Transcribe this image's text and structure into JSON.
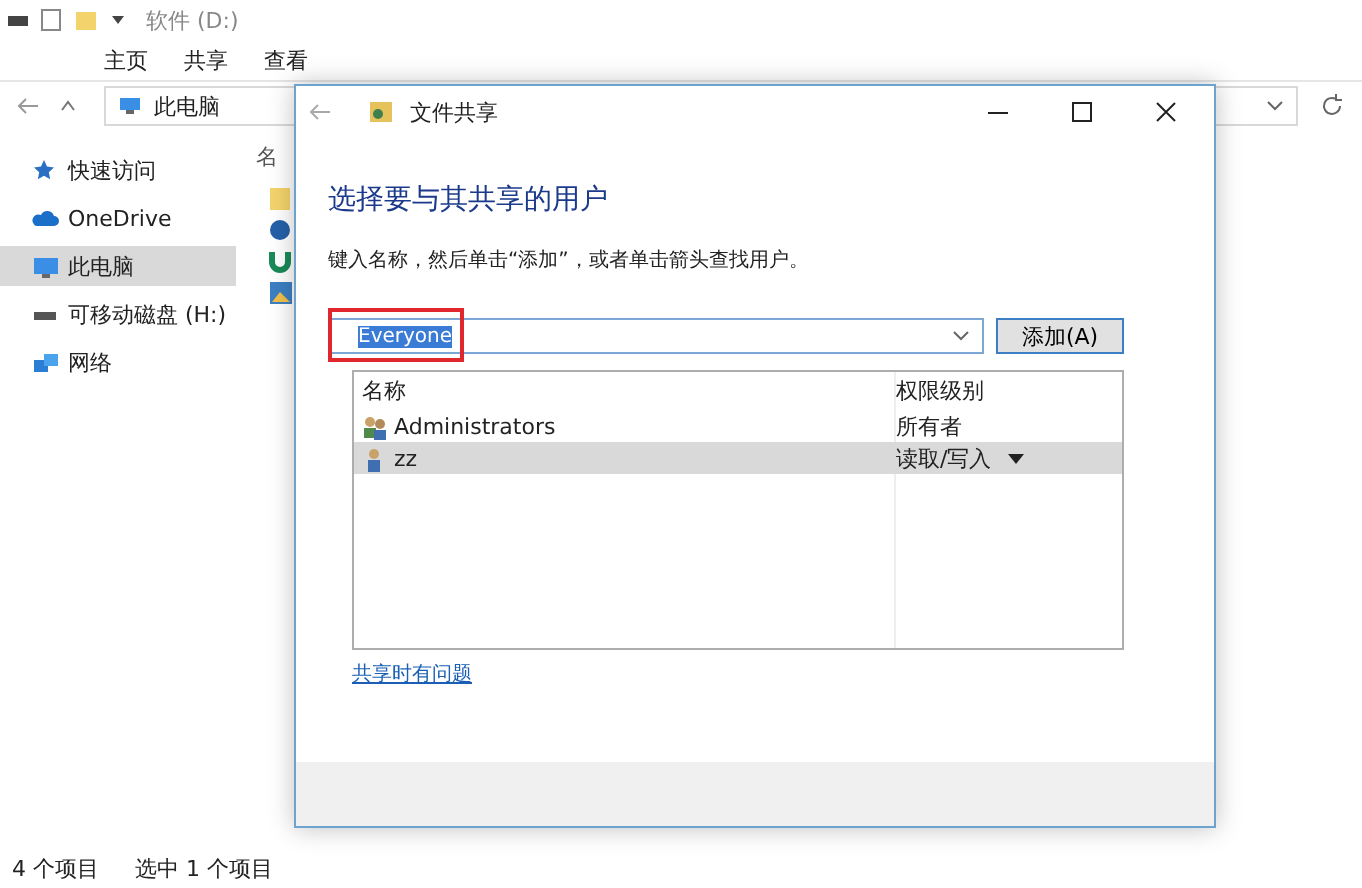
{
  "explorer": {
    "title": "软件 (D:)",
    "ribbon_tabs": [
      {
        "label": "主页"
      },
      {
        "label": "共享"
      },
      {
        "label": "查看"
      }
    ],
    "address": "此电脑",
    "sidebar": {
      "items": [
        {
          "label": "快速访问",
          "kind": "star",
          "selected": false
        },
        {
          "label": "OneDrive",
          "kind": "cloud",
          "selected": false
        },
        {
          "label": "此电脑",
          "kind": "pc",
          "selected": true
        },
        {
          "label": "可移动磁盘 (H:)",
          "kind": "drive",
          "selected": false
        },
        {
          "label": "网络",
          "kind": "network",
          "selected": false
        }
      ]
    },
    "file_list": {
      "column": "名"
    },
    "status_bar": [
      "4 个项目",
      "选中 1 个项目"
    ]
  },
  "dialog": {
    "title": "文件共享",
    "heading": "选择要与其共享的用户",
    "instruction": "键入名称，然后单击“添加”，或者单击箭头查找用户。",
    "name_field": {
      "value": "Everyone",
      "highlighted": true
    },
    "add_button": "添加(A)",
    "table": {
      "columns": [
        "名称",
        "权限级别"
      ],
      "rows": [
        {
          "name": "Administrators",
          "permission": "所有者",
          "kind": "group",
          "selected": false,
          "has_menu": false
        },
        {
          "name": "zz",
          "permission": "读取/写入",
          "kind": "user",
          "selected": true,
          "has_menu": true
        }
      ]
    },
    "help_link": "共享时有问题"
  }
}
